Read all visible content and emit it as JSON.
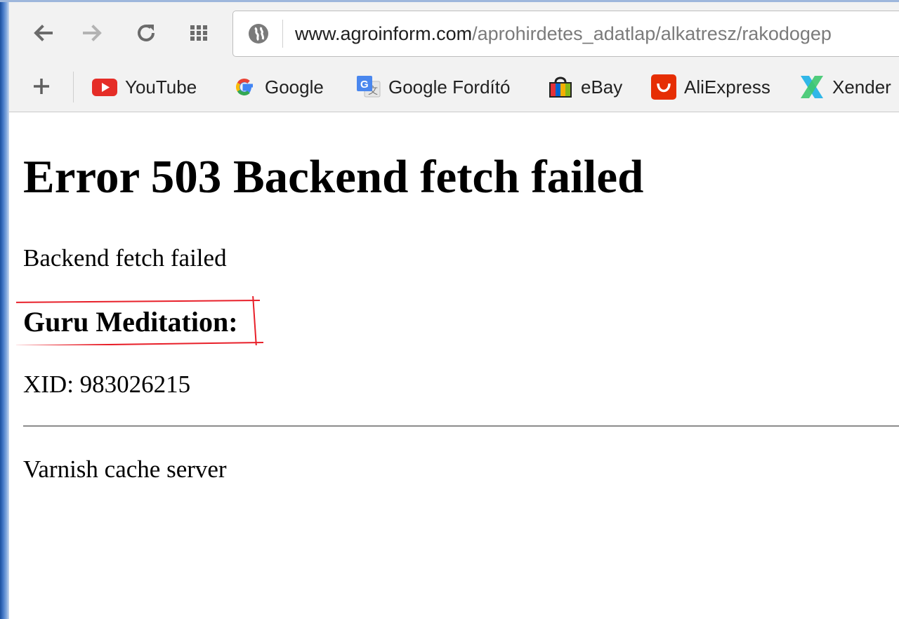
{
  "browser": {
    "address_bar": {
      "url_host": "www.agroinform.com",
      "url_path": "/aprohirdetes_adatlap/alkatresz/rakodogep"
    },
    "bookmarks": [
      {
        "label": "YouTube",
        "icon": "youtube-icon"
      },
      {
        "label": "Google",
        "icon": "google-icon"
      },
      {
        "label": "Google Fordító",
        "icon": "google-translate-icon"
      },
      {
        "label": "eBay",
        "icon": "ebay-icon"
      },
      {
        "label": "AliExpress",
        "icon": "aliexpress-icon"
      },
      {
        "label": "Xender",
        "icon": "xender-icon"
      }
    ]
  },
  "page": {
    "title": "Error 503 Backend fetch failed",
    "message": "Backend fetch failed",
    "guru_heading": "Guru Meditation:",
    "xid": "XID: 983026215",
    "footer": "Varnish cache server"
  },
  "colors": {
    "annotation_red": "#e8202a",
    "toolbar_bg": "#f2f2f2",
    "youtube_red": "#e52d27",
    "aliexpress_red": "#e62e04"
  }
}
